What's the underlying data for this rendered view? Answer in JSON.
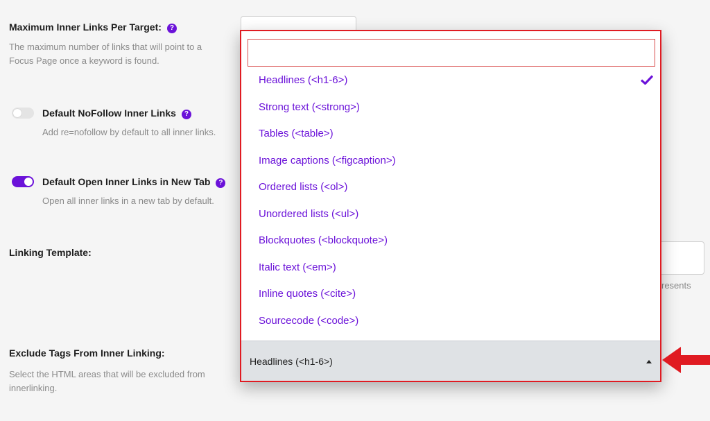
{
  "settings": {
    "max_links": {
      "label": "Maximum Inner Links Per Target:",
      "help": "?",
      "desc_line1": "The maximum number of links that will point to a",
      "desc_line2": "Focus Page once a keyword is found."
    },
    "nofollow": {
      "label": "Default NoFollow Inner Links",
      "help": "?",
      "desc": "Add re=nofollow by default to all inner links.",
      "enabled": false
    },
    "new_tab": {
      "label": "Default Open Inner Links in New Tab",
      "help": "?",
      "desc": "Open all inner links in a new tab by default.",
      "enabled": true
    },
    "linking_template": {
      "label": "Linking Template:",
      "partial_desc": "resents"
    },
    "exclude_tags": {
      "label": "Exclude Tags From Inner Linking:",
      "desc_line1": "Select the HTML areas that will be excluded from",
      "desc_line2": "innerlinking."
    }
  },
  "dropdown": {
    "search_value": "",
    "search_placeholder": "",
    "items": [
      {
        "label": "Headlines (<h1-6>)",
        "selected": true
      },
      {
        "label": "Strong text (<strong>)",
        "selected": false
      },
      {
        "label": "Tables (<table>)",
        "selected": false
      },
      {
        "label": "Image captions (<figcaption>)",
        "selected": false
      },
      {
        "label": "Ordered lists (<ol>)",
        "selected": false
      },
      {
        "label": "Unordered lists (<ul>)",
        "selected": false
      },
      {
        "label": "Blockquotes (<blockquote>)",
        "selected": false
      },
      {
        "label": "Italic text (<em>)",
        "selected": false
      },
      {
        "label": "Inline quotes (<cite>)",
        "selected": false
      },
      {
        "label": "Sourcecode (<code>)",
        "selected": false
      }
    ],
    "selected_display": "Headlines (<h1-6>)"
  },
  "colors": {
    "accent": "#6b12d9",
    "highlight_border": "#e01b22",
    "arrow": "#e01b22"
  },
  "icons": {
    "help": "question-circle-icon",
    "check": "checkmark-icon",
    "caret": "caret-up-icon",
    "annotation": "red-arrow-left-icon"
  }
}
